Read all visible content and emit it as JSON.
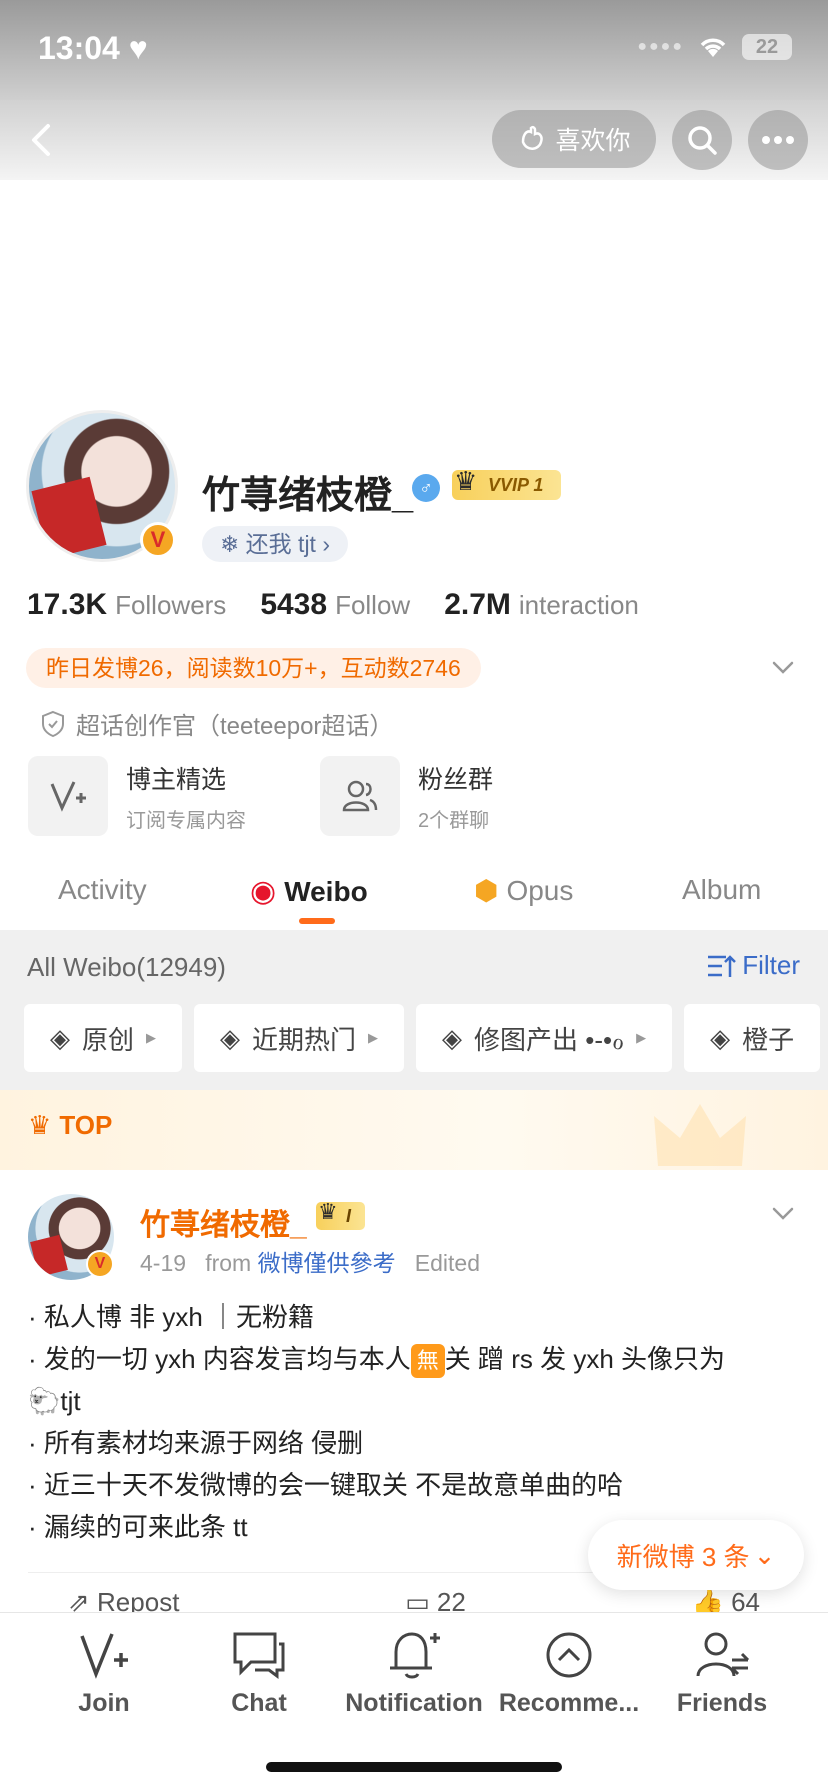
{
  "status_bar": {
    "time": "13:04",
    "battery": "22"
  },
  "header": {
    "like_label": "喜欢你"
  },
  "profile": {
    "name": "竹荨绪枝橙_",
    "vip_badge": "VVIP",
    "vip_level": "1",
    "sub_pill": "还我 tjt",
    "stats": [
      {
        "num": "17.3K",
        "label": "Followers"
      },
      {
        "num": "5438",
        "label": "Follow"
      },
      {
        "num": "2.7M",
        "label": "interaction"
      }
    ],
    "daily_summary": "昨日发博26，阅读数10万+，互动数2746",
    "creator_tag": "超话创作官（teeteepor超话）",
    "features": [
      {
        "title": "博主精选",
        "subtitle": "订阅专属内容"
      },
      {
        "title": "粉丝群",
        "subtitle": "2个群聊"
      }
    ]
  },
  "tabs": [
    {
      "label": "Activity"
    },
    {
      "label": "Weibo"
    },
    {
      "label": "Opus"
    },
    {
      "label": "Album"
    }
  ],
  "filter_section": {
    "all_weibo": "All Weibo(12949)",
    "filter_label": "Filter",
    "chips": [
      "原创",
      "近期热门",
      "修图产出 •-•ℴ",
      "橙子"
    ]
  },
  "top_label": "TOP",
  "post": {
    "author": "竹荨绪枝橙_",
    "crown_level": "I",
    "date": "4-19",
    "from_label": "from",
    "source": "微博僅供參考",
    "edited": "Edited",
    "lines": [
      "· 私人博 非 yxh ｜无粉籍",
      "· 发的一切 yxh 内容发言均与本人",
      "关  蹭 rs 发 yxh 头像只为",
      "tjt",
      "· 所有素材均来源于网络  侵删",
      "· 近三十天不发微博的会一键取关  不是故意单曲的哈",
      "· 漏续的可来此条 tt"
    ],
    "wu_mark": "無",
    "sheep_emoji": "🐑",
    "actions": {
      "repost": "Repost",
      "comments": "22",
      "likes": "64"
    }
  },
  "new_weibo_label": "新微博 3 条",
  "bottom_nav": [
    {
      "label": "Join"
    },
    {
      "label": "Chat"
    },
    {
      "label": "Notification"
    },
    {
      "label": "Recomme..."
    },
    {
      "label": "Friends"
    }
  ]
}
